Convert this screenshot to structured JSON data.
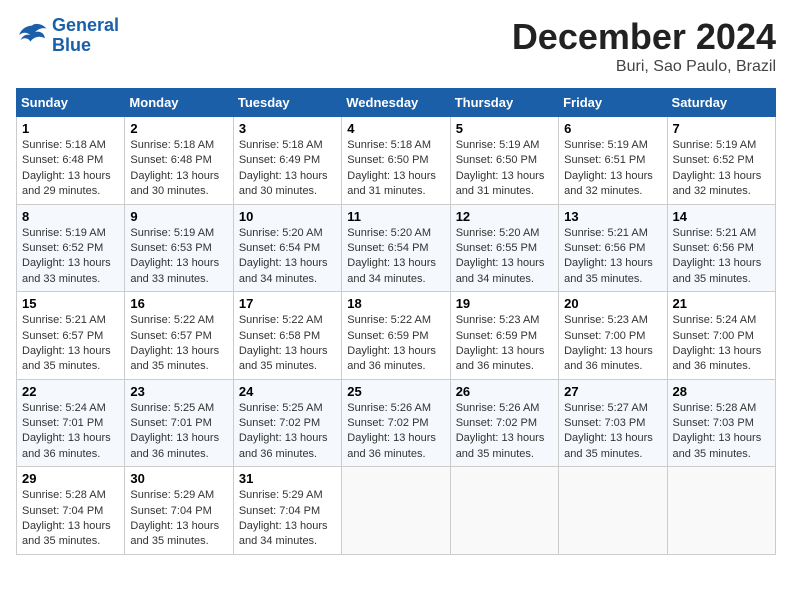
{
  "logo": {
    "line1": "General",
    "line2": "Blue"
  },
  "title": "December 2024",
  "location": "Buri, Sao Paulo, Brazil",
  "weekdays": [
    "Sunday",
    "Monday",
    "Tuesday",
    "Wednesday",
    "Thursday",
    "Friday",
    "Saturday"
  ],
  "weeks": [
    [
      {
        "day": "1",
        "sunrise": "5:18 AM",
        "sunset": "6:48 PM",
        "daylight": "13 hours and 29 minutes."
      },
      {
        "day": "2",
        "sunrise": "5:18 AM",
        "sunset": "6:48 PM",
        "daylight": "13 hours and 30 minutes."
      },
      {
        "day": "3",
        "sunrise": "5:18 AM",
        "sunset": "6:49 PM",
        "daylight": "13 hours and 30 minutes."
      },
      {
        "day": "4",
        "sunrise": "5:18 AM",
        "sunset": "6:50 PM",
        "daylight": "13 hours and 31 minutes."
      },
      {
        "day": "5",
        "sunrise": "5:19 AM",
        "sunset": "6:50 PM",
        "daylight": "13 hours and 31 minutes."
      },
      {
        "day": "6",
        "sunrise": "5:19 AM",
        "sunset": "6:51 PM",
        "daylight": "13 hours and 32 minutes."
      },
      {
        "day": "7",
        "sunrise": "5:19 AM",
        "sunset": "6:52 PM",
        "daylight": "13 hours and 32 minutes."
      }
    ],
    [
      {
        "day": "8",
        "sunrise": "5:19 AM",
        "sunset": "6:52 PM",
        "daylight": "13 hours and 33 minutes."
      },
      {
        "day": "9",
        "sunrise": "5:19 AM",
        "sunset": "6:53 PM",
        "daylight": "13 hours and 33 minutes."
      },
      {
        "day": "10",
        "sunrise": "5:20 AM",
        "sunset": "6:54 PM",
        "daylight": "13 hours and 34 minutes."
      },
      {
        "day": "11",
        "sunrise": "5:20 AM",
        "sunset": "6:54 PM",
        "daylight": "13 hours and 34 minutes."
      },
      {
        "day": "12",
        "sunrise": "5:20 AM",
        "sunset": "6:55 PM",
        "daylight": "13 hours and 34 minutes."
      },
      {
        "day": "13",
        "sunrise": "5:21 AM",
        "sunset": "6:56 PM",
        "daylight": "13 hours and 35 minutes."
      },
      {
        "day": "14",
        "sunrise": "5:21 AM",
        "sunset": "6:56 PM",
        "daylight": "13 hours and 35 minutes."
      }
    ],
    [
      {
        "day": "15",
        "sunrise": "5:21 AM",
        "sunset": "6:57 PM",
        "daylight": "13 hours and 35 minutes."
      },
      {
        "day": "16",
        "sunrise": "5:22 AM",
        "sunset": "6:57 PM",
        "daylight": "13 hours and 35 minutes."
      },
      {
        "day": "17",
        "sunrise": "5:22 AM",
        "sunset": "6:58 PM",
        "daylight": "13 hours and 35 minutes."
      },
      {
        "day": "18",
        "sunrise": "5:22 AM",
        "sunset": "6:59 PM",
        "daylight": "13 hours and 36 minutes."
      },
      {
        "day": "19",
        "sunrise": "5:23 AM",
        "sunset": "6:59 PM",
        "daylight": "13 hours and 36 minutes."
      },
      {
        "day": "20",
        "sunrise": "5:23 AM",
        "sunset": "7:00 PM",
        "daylight": "13 hours and 36 minutes."
      },
      {
        "day": "21",
        "sunrise": "5:24 AM",
        "sunset": "7:00 PM",
        "daylight": "13 hours and 36 minutes."
      }
    ],
    [
      {
        "day": "22",
        "sunrise": "5:24 AM",
        "sunset": "7:01 PM",
        "daylight": "13 hours and 36 minutes."
      },
      {
        "day": "23",
        "sunrise": "5:25 AM",
        "sunset": "7:01 PM",
        "daylight": "13 hours and 36 minutes."
      },
      {
        "day": "24",
        "sunrise": "5:25 AM",
        "sunset": "7:02 PM",
        "daylight": "13 hours and 36 minutes."
      },
      {
        "day": "25",
        "sunrise": "5:26 AM",
        "sunset": "7:02 PM",
        "daylight": "13 hours and 36 minutes."
      },
      {
        "day": "26",
        "sunrise": "5:26 AM",
        "sunset": "7:02 PM",
        "daylight": "13 hours and 35 minutes."
      },
      {
        "day": "27",
        "sunrise": "5:27 AM",
        "sunset": "7:03 PM",
        "daylight": "13 hours and 35 minutes."
      },
      {
        "day": "28",
        "sunrise": "5:28 AM",
        "sunset": "7:03 PM",
        "daylight": "13 hours and 35 minutes."
      }
    ],
    [
      {
        "day": "29",
        "sunrise": "5:28 AM",
        "sunset": "7:04 PM",
        "daylight": "13 hours and 35 minutes."
      },
      {
        "day": "30",
        "sunrise": "5:29 AM",
        "sunset": "7:04 PM",
        "daylight": "13 hours and 35 minutes."
      },
      {
        "day": "31",
        "sunrise": "5:29 AM",
        "sunset": "7:04 PM",
        "daylight": "13 hours and 34 minutes."
      },
      null,
      null,
      null,
      null
    ]
  ]
}
